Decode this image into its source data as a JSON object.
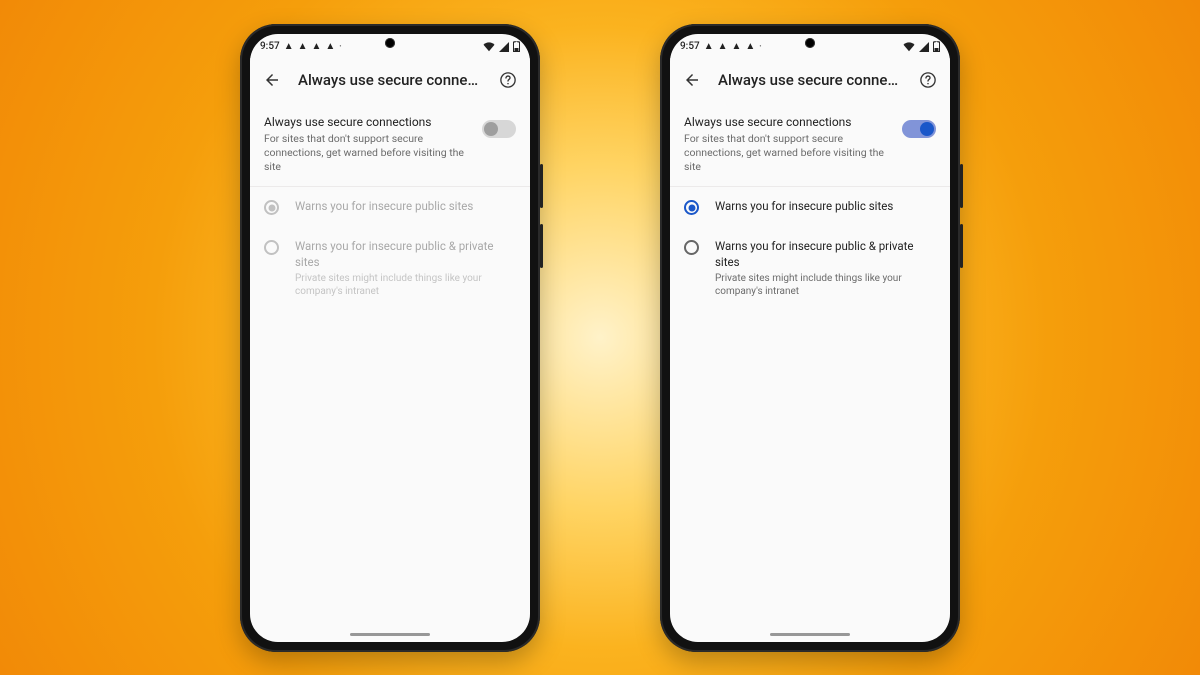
{
  "status": {
    "time": "9:57",
    "warning_glyph": "▲",
    "dot_glyph": "•"
  },
  "appbar": {
    "title": "Always use secure connecti…"
  },
  "setting": {
    "title": "Always use secure connections",
    "subtitle": "For sites that don't support secure connections, get warned before visiting the site"
  },
  "options": {
    "public": {
      "label": "Warns you for insecure public sites"
    },
    "private": {
      "label": "Warns you for insecure public & private sites",
      "sub": "Private sites might include things like your company's intranet"
    }
  },
  "phones": [
    {
      "toggle_on": false,
      "options_enabled": false
    },
    {
      "toggle_on": true,
      "options_enabled": true
    }
  ]
}
